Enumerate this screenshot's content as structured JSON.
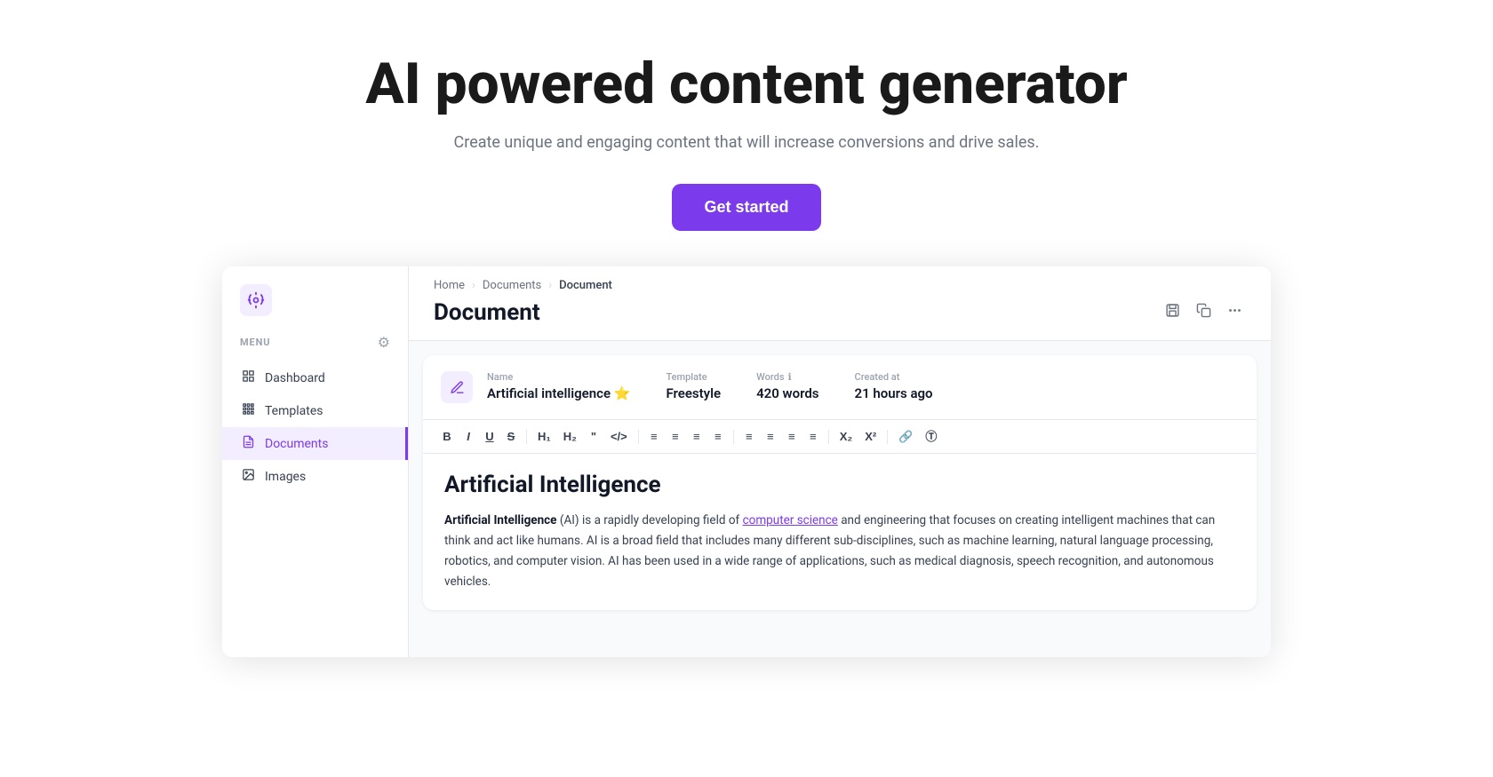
{
  "hero": {
    "title": "AI powered content generator",
    "subtitle": "Create unique and engaging content that will increase conversions and drive sales.",
    "cta_label": "Get started"
  },
  "sidebar": {
    "logo_icon": "⚙",
    "menu_label": "MENU",
    "settings_icon": "⚙",
    "items": [
      {
        "id": "dashboard",
        "icon": "▦",
        "label": "Dashboard",
        "active": false
      },
      {
        "id": "templates",
        "icon": "⠿",
        "label": "Templates",
        "active": false
      },
      {
        "id": "documents",
        "icon": "☰",
        "label": "Documents",
        "active": true
      },
      {
        "id": "images",
        "icon": "🖼",
        "label": "Images",
        "active": false
      }
    ]
  },
  "breadcrumb": {
    "items": [
      "Home",
      "Documents",
      "Document"
    ]
  },
  "page": {
    "title": "Document"
  },
  "toolbar": {
    "save_icon": "⊞",
    "copy_icon": "⧉",
    "more_icon": "···"
  },
  "doc_meta": {
    "name_label": "Name",
    "name_value": "Artificial intelligence",
    "name_star": "⭐",
    "template_label": "Template",
    "template_value": "Freestyle",
    "words_label": "Words",
    "words_value": "420 words",
    "created_label": "Created at",
    "created_value": "21 hours ago"
  },
  "editor": {
    "heading": "Artificial Intelligence",
    "intro_bold": "Artificial Intelligence",
    "intro_text": " (AI) is a rapidly developing field of ",
    "intro_link": "computer science",
    "intro_rest": " and engineering that focuses on creating intelligent machines that can think and act like humans. AI is a broad field that includes many different sub-disciplines, such as machine learning, natural language processing, robotics, and computer vision. AI has been used in a wide range of applications, such as medical diagnosis, speech recognition, and autonomous vehicles."
  }
}
